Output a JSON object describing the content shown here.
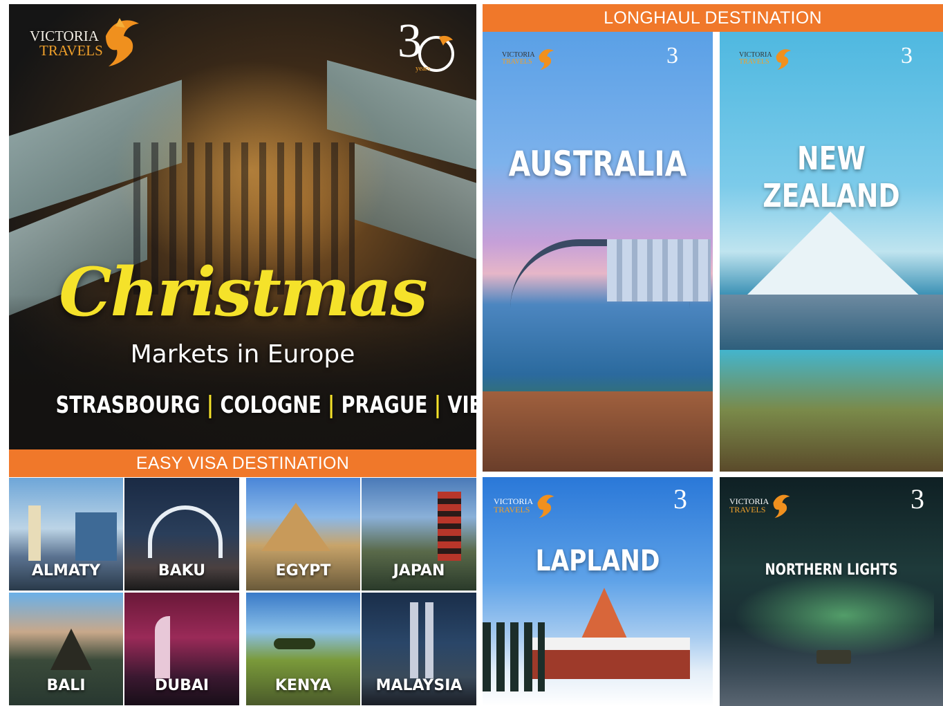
{
  "brand": {
    "line1": "VICTORIA",
    "line2": "TRAVELS",
    "anniv_number": "3",
    "anniv_word": "years"
  },
  "hero": {
    "title_script": "Christmas",
    "subtitle": "Markets in Europe",
    "cities": [
      "STRASBOURG",
      "COLOGNE",
      "PRAGUE",
      "VIENNA"
    ],
    "separator": "|"
  },
  "sections": {
    "longhaul": "LONGHAUL DESTINATION",
    "easy_visa": "EASY VISA DESTINATION"
  },
  "longhaul_tiles": [
    "AUSTRALIA",
    "NEW ZEALAND",
    "LAPLAND",
    "NORTHERN LIGHTS"
  ],
  "easy_visa_tiles": [
    "ALMATY",
    "BAKU",
    "EGYPT",
    "JAPAN",
    "BALI",
    "DUBAI",
    "KENYA",
    "MALAYSIA"
  ],
  "colors": {
    "accent": "#f0782a",
    "hero_title": "#f5e22a"
  }
}
